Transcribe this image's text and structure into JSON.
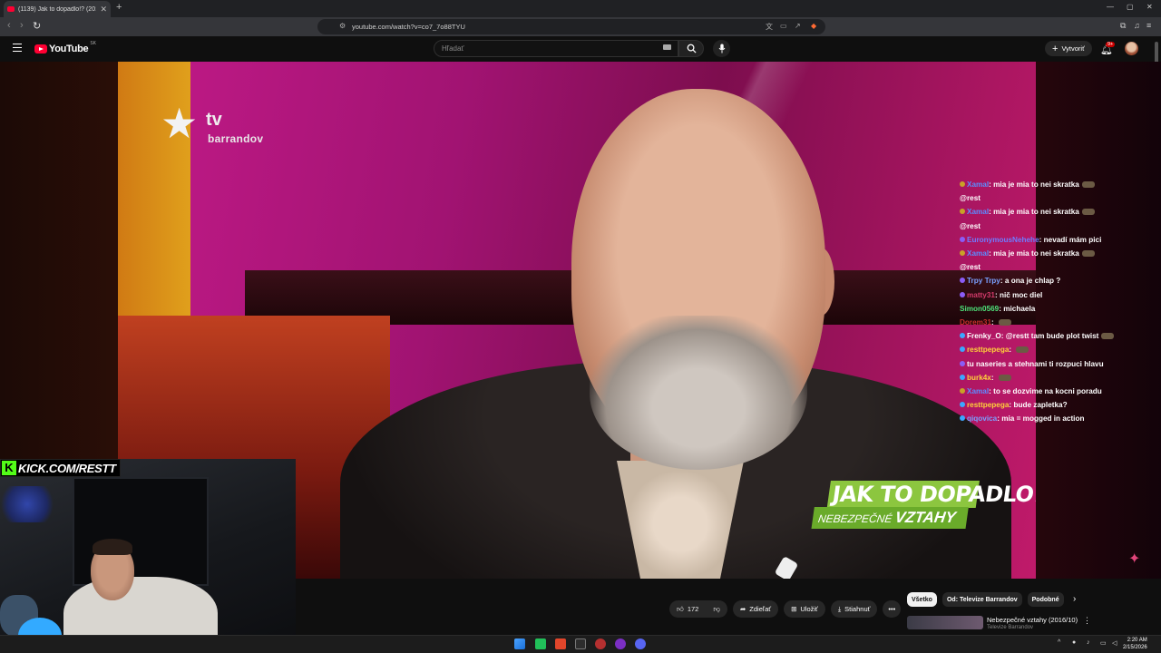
{
  "browser": {
    "tab_title": "(1139) Jak to dopadlo!? (2016...",
    "url": "youtube.com/watch?v=co7_7o88TYU",
    "new_tab": "+"
  },
  "youtube": {
    "logo_text": "YouTube",
    "country_code": "SK",
    "search_placeholder": "Hľadať",
    "create_label": "Vytvoriť",
    "notification_badge": "9+"
  },
  "video": {
    "channel_logo_tv": "tv",
    "channel_logo_brand": "barrandov",
    "show_title_top": "JAK TO DOPADLO!?",
    "show_title_bottom_a": "NEBEZPEČNÉ ",
    "show_title_bottom_b": "VZTAHY"
  },
  "stream_overlay": {
    "kick_handle": "KICK.COM/RESTT"
  },
  "chat": {
    "messages": [
      {
        "user": "Xamal",
        "sep": ": ",
        "text": "mia je mia to nei skratka",
        "user_color": "#5b8cff",
        "badge_color": "#c9a227",
        "emote": true
      },
      {
        "user": "",
        "sep": "",
        "text": "@rest",
        "user_color": "#fff",
        "badge_color": "",
        "emote": false
      },
      {
        "user": "Xamal",
        "sep": ": ",
        "text": "mia je mia to nei skratka",
        "user_color": "#5b8cff",
        "badge_color": "#c9a227",
        "emote": true
      },
      {
        "user": "",
        "sep": "",
        "text": "@rest",
        "user_color": "#fff",
        "badge_color": "",
        "emote": false
      },
      {
        "user": "EuronymousNehehe",
        "sep": ": ",
        "text": "nevadí mám pici",
        "user_color": "#6f7bff",
        "badge_color": "#8b5cf6",
        "emote": false
      },
      {
        "user": "Xamal",
        "sep": ": ",
        "text": "mia je mia to nei skratka",
        "user_color": "#5b8cff",
        "badge_color": "#c9a227",
        "emote": true
      },
      {
        "user": "",
        "sep": "",
        "text": "@rest",
        "user_color": "#fff",
        "badge_color": "",
        "emote": false
      },
      {
        "user": "Trpy Trpy",
        "sep": ": ",
        "text": "a ona je chlap ?",
        "user_color": "#7aa0ff",
        "badge_color": "#8b5cf6",
        "emote": false
      },
      {
        "user": "matty31",
        "sep": ": ",
        "text": "nič moc diel",
        "user_color": "#d23a6a",
        "badge_color": "#8b5cf6",
        "emote": false
      },
      {
        "user": "Simon0569",
        "sep": ": ",
        "text": "michaela",
        "user_color": "#4ee37a",
        "badge_color": "",
        "emote": false
      },
      {
        "user": "Dorem31",
        "sep": ": ",
        "text": "",
        "user_color": "#c9302c",
        "badge_color": "",
        "emote": true
      },
      {
        "user": "Frenky_O",
        "sep": ": ",
        "text": "@restt tam bude plot twist",
        "user_color": "#ffffff",
        "badge_color": "#3ba7ff",
        "emote": true
      },
      {
        "user": "resttpepega",
        "sep": ": ",
        "text": "",
        "user_color": "#ffd23a",
        "badge_color": "#3ba7ff",
        "emote": true
      },
      {
        "user": "",
        "sep": "",
        "text": "tu naseries a stehnami ti rozpuci hlavu",
        "user_color": "#8b5cf6",
        "badge_color": "#8b5cf6",
        "emote": false
      },
      {
        "user": "burk4x",
        "sep": ": ",
        "text": "",
        "user_color": "#ffd23a",
        "badge_color": "#3ba7ff",
        "emote": true
      },
      {
        "user": "Xamal",
        "sep": ": ",
        "text": "to se dozvime na kocni poradu",
        "user_color": "#5b8cff",
        "badge_color": "#c9a227",
        "emote": false
      },
      {
        "user": "resttpepega",
        "sep": ": ",
        "text": "bude zapletka?",
        "user_color": "#ffd23a",
        "badge_color": "#3ba7ff",
        "emote": false
      },
      {
        "user": "qiqovica",
        "sep": ": ",
        "text": "mia = mogged in action",
        "user_color": "#7aa0ff",
        "badge_color": "#3ba7ff",
        "emote": false
      }
    ]
  },
  "actions": {
    "like_count": "172",
    "share_label": "Zdieľať",
    "save_label": "Uložiť",
    "download_label": "Stiahnuť",
    "more_label": "•••"
  },
  "chips": [
    "Všetko",
    "Od: Televize Barrandov",
    "Podobné"
  ],
  "recommendation": {
    "title": "Nebezpečné vztahy (2016/10)",
    "channel": "Televize Barrandov"
  },
  "taskbar": {
    "time": "2:20 AM",
    "date": "2/15/2026"
  }
}
